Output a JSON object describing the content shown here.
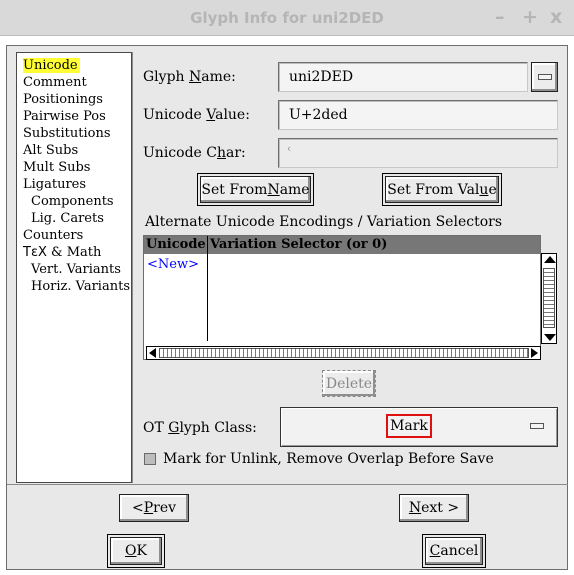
{
  "window": {
    "title": "Glyph Info for uni2DED",
    "controls": [
      "–",
      "+",
      "x"
    ]
  },
  "sidebar": {
    "items": [
      {
        "label": "Unicode",
        "selected": true
      },
      {
        "label": "Comment"
      },
      {
        "label": "Positionings"
      },
      {
        "label": "Pairwise Pos"
      },
      {
        "label": "Substitutions"
      },
      {
        "label": "Alt Subs"
      },
      {
        "label": "Mult Subs"
      },
      {
        "label": "Ligatures"
      },
      {
        "label": "Components"
      },
      {
        "label": "Lig. Carets"
      },
      {
        "label": "Counters"
      },
      {
        "label_prefix": "TεX",
        "label_suffix": " & Math"
      },
      {
        "label": "Vert. Variants"
      },
      {
        "label": "Horiz. Variants"
      }
    ]
  },
  "form": {
    "glyph_name": {
      "label_pre": "Glyph ",
      "label_key": "N",
      "label_post": "ame:",
      "value": "uni2DED"
    },
    "unicode_value": {
      "label_pre": "Unicode ",
      "label_key": "V",
      "label_post": "alue:",
      "value": "U+2ded"
    },
    "unicode_char": {
      "label_pre": "Unicode C",
      "label_key": "h",
      "label_post": "ar:",
      "value": "ⷭ"
    },
    "set_from_name": {
      "pre": "Set From ",
      "key": "N",
      "post": "ame"
    },
    "set_from_value": {
      "pre": "Set From Val",
      "key": "u",
      "post": "e"
    }
  },
  "alt_encodings": {
    "title": "Alternate Unicode Encodings / Variation Selectors",
    "columns": [
      "Unicode",
      "Variation Selector (or 0)"
    ],
    "new_row": "<New>",
    "delete_label": "Delete"
  },
  "ot_glyph_class": {
    "label_pre": "OT ",
    "label_key": "G",
    "label_post": "lyph Class:",
    "value": "Mark"
  },
  "mark_for_unlink": {
    "label": "Mark for Unlink, Remove Overlap Before Save",
    "checked": false
  },
  "nav": {
    "prev": {
      "pre": "< ",
      "key": "P",
      "post": "rev"
    },
    "next": {
      "pre": "",
      "key": "N",
      "post": "ext >"
    },
    "ok": {
      "pre": "",
      "key": "O",
      "post": "K"
    },
    "cancel": {
      "pre": "",
      "key": "C",
      "post": "ancel"
    }
  },
  "colors": {
    "selected_item": "#ffff33",
    "highlight_box": "#e01010",
    "new_row_text": "#0000ff"
  }
}
